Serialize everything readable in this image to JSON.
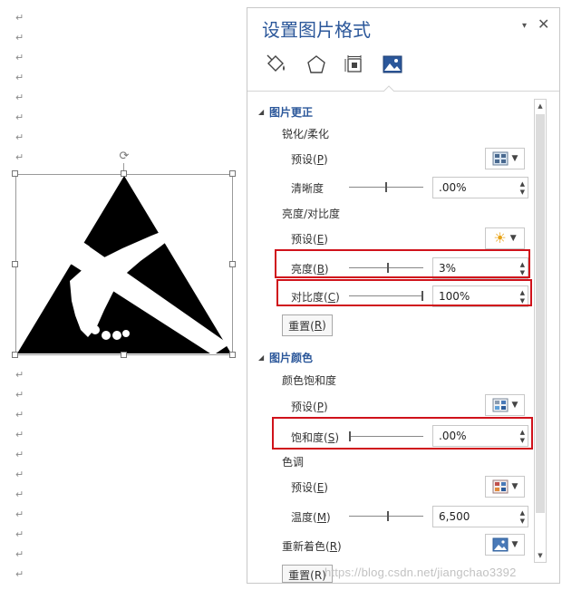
{
  "document": {
    "para_mark": "↵",
    "para_marks_count": 29
  },
  "pane": {
    "title": "设置图片格式",
    "menu_glyph": "▾",
    "close_glyph": "✕",
    "tabs": [
      {
        "name": "fill-line",
        "icon": "paint-bucket-icon"
      },
      {
        "name": "effects",
        "icon": "pentagon-icon"
      },
      {
        "name": "layout-properties",
        "icon": "size-properties-icon"
      },
      {
        "name": "picture",
        "icon": "picture-icon",
        "active": true
      }
    ]
  },
  "picture_corrections": {
    "section_title": "图片更正",
    "sharpen_title": "锐化/柔化",
    "sharpen_preset_label": "预设(",
    "sharpen_preset_key": "P",
    "sharpness_label": "清晰度",
    "sharpness_value": ".00%",
    "sharpness_level": 0.5,
    "brightness_contrast_title": "亮度/对比度",
    "bc_preset_label": "预设(",
    "bc_preset_key": "E",
    "brightness_label": "亮度(",
    "brightness_key": "B",
    "brightness_value": "3%",
    "brightness_level": 0.52,
    "contrast_label": "对比度(",
    "contrast_key": "C",
    "contrast_value": "100%",
    "contrast_level": 1.0,
    "reset_label": "重置(",
    "reset_key": "R"
  },
  "picture_color": {
    "section_title": "图片颜色",
    "saturation_title": "颜色饱和度",
    "saturation_preset_label": "预设(",
    "saturation_preset_key": "P",
    "saturation_label": "饱和度(",
    "saturation_key": "S",
    "saturation_value": ".00%",
    "saturation_level": 0.0,
    "tone_title": "色调",
    "tone_preset_label": "预设(",
    "tone_preset_key": "E",
    "temperature_label": "温度(",
    "temperature_key": "M",
    "temperature_value": "6,500",
    "temperature_level": 0.52,
    "recolor_label": "重新着色(",
    "recolor_key": "R",
    "reset_label_partial": "重置(R)"
  },
  "close_paren": ")",
  "watermark": "https://blog.csdn.net/jiangchao3392",
  "colors": {
    "accent": "#2b579a",
    "highlight": "#d0121b"
  }
}
